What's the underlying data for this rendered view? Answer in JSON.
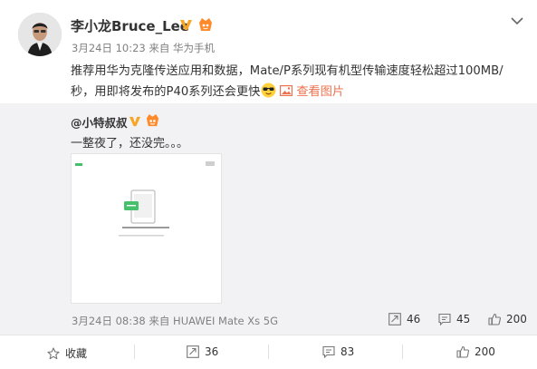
{
  "post": {
    "author": "李小龙Bruce_Lee",
    "date": "3月24日 10:23",
    "source": "来自 华为手机",
    "text": "推荐用华为克隆传送应用和数据，Mate/P系列现有机型传输速度轻松超过100MB/秒，用即将发布的P40系列还会更快",
    "view_pic_label": "查看图片"
  },
  "repost": {
    "user": "@小特叔叔",
    "text": "一整夜了，还没完。。。",
    "thumbnail_text": "已传入 42% 的数据",
    "date": "3月24日 08:38",
    "source": "来自 HUAWEI Mate Xs 5G",
    "forward_count": "46",
    "comment_count": "45",
    "like_count": "200"
  },
  "actions": {
    "favorite_label": "收藏",
    "forward_count": "36",
    "comment_count": "83",
    "like_count": "200"
  },
  "colors": {
    "accent_orange": "#eb7350",
    "verified_badge": "#f6a623",
    "repost_bg": "#f2f2f5"
  },
  "icons": [
    "chevron-down-icon",
    "verified-v-icon",
    "vip-icon",
    "sunglasses-emoji-icon",
    "image-icon",
    "forward-icon",
    "comment-icon",
    "like-icon",
    "star-icon"
  ]
}
